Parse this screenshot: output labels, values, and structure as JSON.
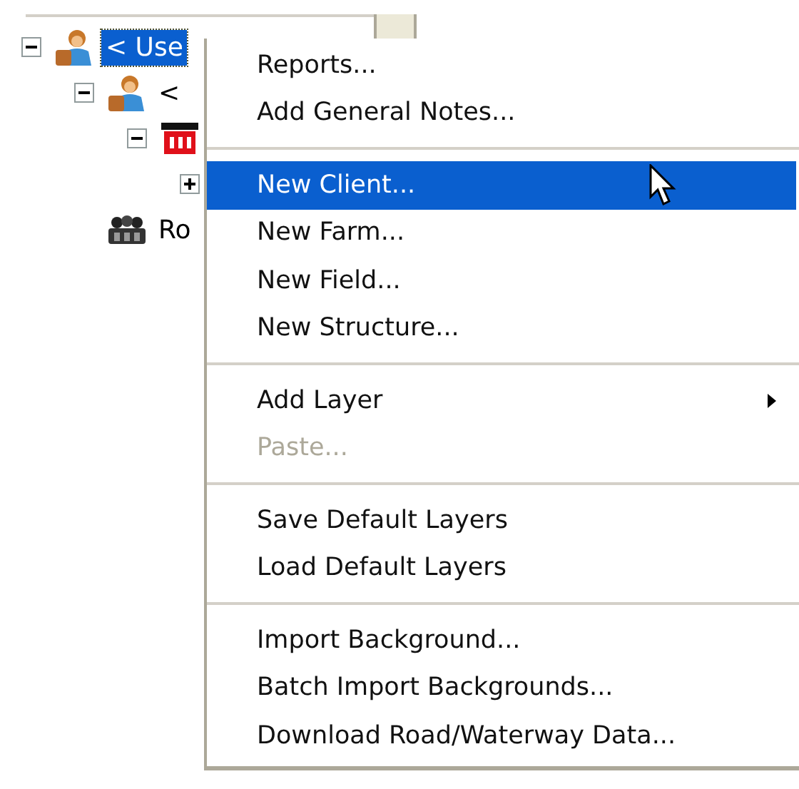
{
  "tree": [
    {
      "label": "< Use",
      "kind": "user",
      "expanded": true,
      "selected": true,
      "children": [
        {
          "label": "<",
          "kind": "user",
          "expanded": true,
          "selected": false,
          "children": [
            {
              "kind": "farm",
              "expanded": true,
              "children": [
                {
                  "expanded": false
                }
              ]
            }
          ]
        },
        {
          "label": "Ro",
          "kind": "group",
          "selected": false
        }
      ]
    }
  ],
  "context_menu": [
    {
      "kind": "item",
      "label": "Reports...",
      "selected": false,
      "disabled": false,
      "submenu": false
    },
    {
      "kind": "item",
      "label": "Add General Notes...",
      "selected": false,
      "disabled": false,
      "submenu": false
    },
    {
      "kind": "separator"
    },
    {
      "kind": "item",
      "label": "New Client...",
      "selected": true,
      "disabled": false,
      "submenu": false
    },
    {
      "kind": "item",
      "label": "New Farm...",
      "selected": false,
      "disabled": false,
      "submenu": false
    },
    {
      "kind": "item",
      "label": "New Field...",
      "selected": false,
      "disabled": false,
      "submenu": false
    },
    {
      "kind": "item",
      "label": "New Structure...",
      "selected": false,
      "disabled": false,
      "submenu": false
    },
    {
      "kind": "separator"
    },
    {
      "kind": "item",
      "label": "Add Layer",
      "selected": false,
      "disabled": false,
      "submenu": true
    },
    {
      "kind": "item",
      "label": "Paste...",
      "selected": false,
      "disabled": true,
      "submenu": false
    },
    {
      "kind": "separator"
    },
    {
      "kind": "item",
      "label": "Save Default Layers",
      "selected": false,
      "disabled": false,
      "submenu": false
    },
    {
      "kind": "item",
      "label": "Load Default Layers",
      "selected": false,
      "disabled": false,
      "submenu": false
    },
    {
      "kind": "separator"
    },
    {
      "kind": "item",
      "label": "Import Background...",
      "selected": false,
      "disabled": false,
      "submenu": false
    },
    {
      "kind": "item",
      "label": "Batch Import Backgrounds...",
      "selected": false,
      "disabled": false,
      "submenu": false
    },
    {
      "kind": "item",
      "label": "Download Road/Waterway Data...",
      "selected": false,
      "disabled": false,
      "submenu": false
    }
  ]
}
